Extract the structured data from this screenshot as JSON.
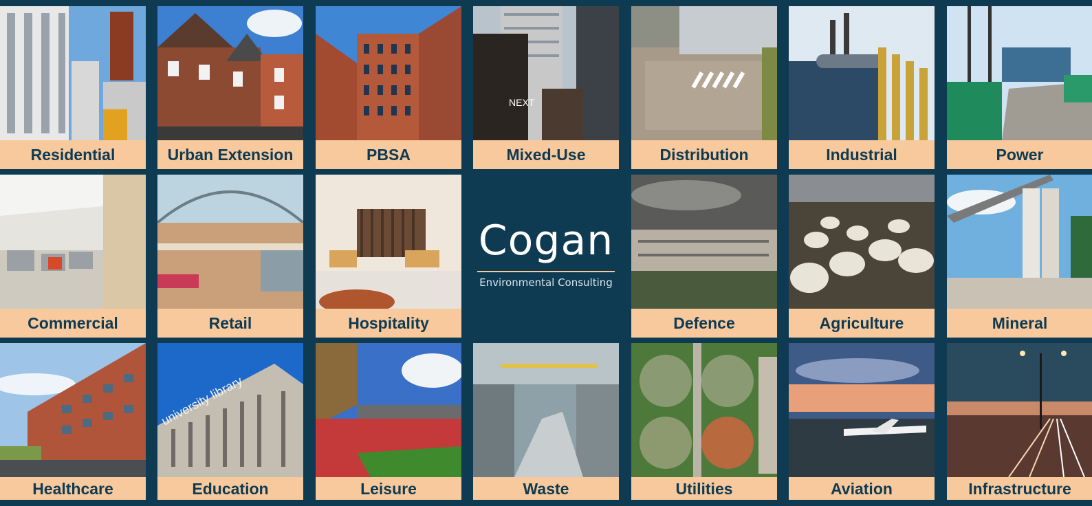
{
  "logo": {
    "name": "Cogan",
    "tagline": "Environmental Consulting"
  },
  "sectors": [
    {
      "label": "Residential",
      "image": "residential-photo"
    },
    {
      "label": "Urban Extension",
      "image": "urban-extension-photo"
    },
    {
      "label": "PBSA",
      "image": "pbsa-photo"
    },
    {
      "label": "Mixed-Use",
      "image": "mixed-use-photo"
    },
    {
      "label": "Distribution",
      "image": "distribution-photo"
    },
    {
      "label": "Industrial",
      "image": "industrial-photo"
    },
    {
      "label": "Power",
      "image": "power-photo"
    },
    {
      "label": "Commercial",
      "image": "commercial-photo"
    },
    {
      "label": "Retail",
      "image": "retail-photo"
    },
    {
      "label": "Hospitality",
      "image": "hospitality-photo"
    },
    {
      "label": "Defence",
      "image": "defence-photo"
    },
    {
      "label": "Agriculture",
      "image": "agriculture-photo"
    },
    {
      "label": "Mineral",
      "image": "mineral-photo"
    },
    {
      "label": "Healthcare",
      "image": "healthcare-photo"
    },
    {
      "label": "Education",
      "image": "education-photo"
    },
    {
      "label": "Leisure",
      "image": "leisure-photo"
    },
    {
      "label": "Waste",
      "image": "waste-photo"
    },
    {
      "label": "Utilities",
      "image": "utilities-photo"
    },
    {
      "label": "Aviation",
      "image": "aviation-photo"
    },
    {
      "label": "Infrastructure",
      "image": "infrastructure-photo"
    }
  ],
  "colors": {
    "background": "#0e3a52",
    "label_bg": "#f8c99d",
    "label_text": "#0e3a52"
  }
}
